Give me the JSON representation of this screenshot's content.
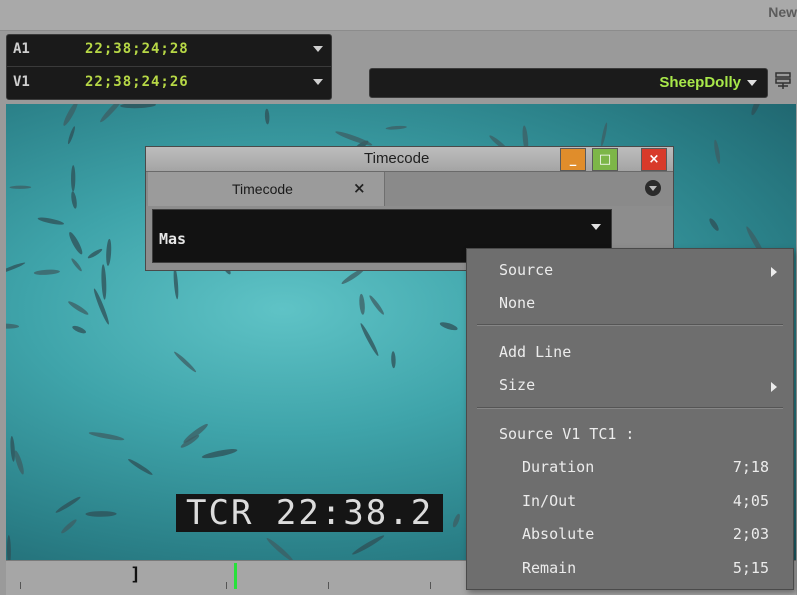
{
  "header": {
    "project_name": "New"
  },
  "timecode_panel": {
    "rows": [
      {
        "track": "A1",
        "timecode": "22;38;24;28"
      },
      {
        "track": "V1",
        "timecode": "22;38;24;26"
      }
    ]
  },
  "clip_select": {
    "name": "SheepDolly"
  },
  "viewer": {
    "burnin": "TCR 22:38.2"
  },
  "timeline": {
    "mark": "]"
  },
  "timecode_window": {
    "title": "Timecode",
    "tab_label": "Timecode",
    "tab_close": "×",
    "minimize": "_",
    "maximize": "□",
    "close": "×",
    "field_value": "Mas"
  },
  "context_menu": {
    "source": "Source",
    "none": "None",
    "add_line": "Add Line",
    "size": "Size",
    "section_header": "Source V1 TC1  :",
    "rows": [
      {
        "label": "Duration",
        "value": "7;18"
      },
      {
        "label": "In/Out",
        "value": "4;05"
      },
      {
        "label": "Absolute",
        "value": "2;03"
      },
      {
        "label": "Remain",
        "value": "5;15"
      }
    ]
  },
  "colors": {
    "timecode_green": "#b7d846",
    "clip_name_green": "#a8e84a",
    "playhead_green": "#27e13a",
    "close_red": "#d83a2a",
    "minimize_orange": "#e08d2b",
    "maximize_green": "#7db648"
  }
}
